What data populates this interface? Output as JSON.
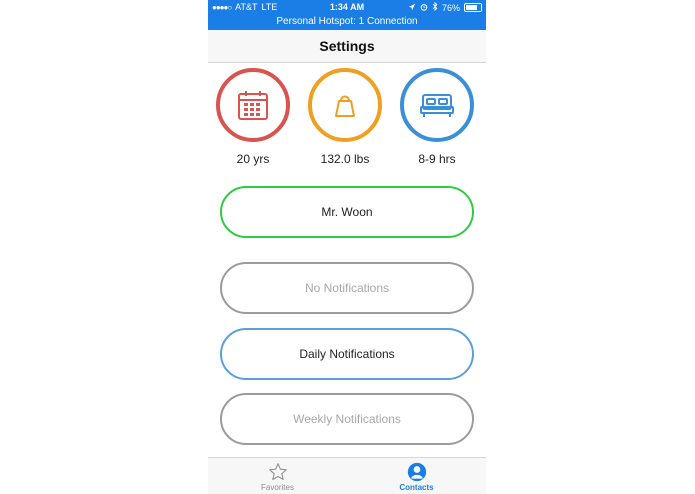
{
  "status_bar": {
    "carrier": "AT&T",
    "network": "LTE",
    "time": "1:34 AM",
    "battery_percent": "76%",
    "battery_level": 0.76,
    "icons": [
      "signal-dots-icon",
      "location-icon",
      "alarm-icon",
      "bluetooth-icon",
      "battery-icon"
    ]
  },
  "hotspot_banner": "Personal Hotspot: 1 Connection",
  "nav": {
    "title": "Settings"
  },
  "stats": [
    {
      "icon": "calendar-icon",
      "value": "20 yrs",
      "color": "#d9534f"
    },
    {
      "icon": "weight-icon",
      "value": "132.0 lbs",
      "color": "#f0a020"
    },
    {
      "icon": "bed-icon",
      "value": "8-9 hrs",
      "color": "#3a8fd8"
    }
  ],
  "profile_button": {
    "label": "Mr. Woon",
    "border_color": "#2ecc40"
  },
  "notification_options": [
    {
      "label": "No Notifications",
      "selected": false
    },
    {
      "label": "Daily Notifications",
      "selected": true
    },
    {
      "label": "Weekly Notifications",
      "selected": false
    }
  ],
  "colors": {
    "accent": "#1a7ee6",
    "unselected_border": "#9b9b9b",
    "selected_border": "#5b9fe0",
    "unselected_text": "#a8a8a8"
  },
  "tab_bar": {
    "tabs": [
      {
        "label": "Favorites",
        "icon": "star-icon",
        "active": false
      },
      {
        "label": "Contacts",
        "icon": "contacts-icon",
        "active": true
      }
    ]
  }
}
